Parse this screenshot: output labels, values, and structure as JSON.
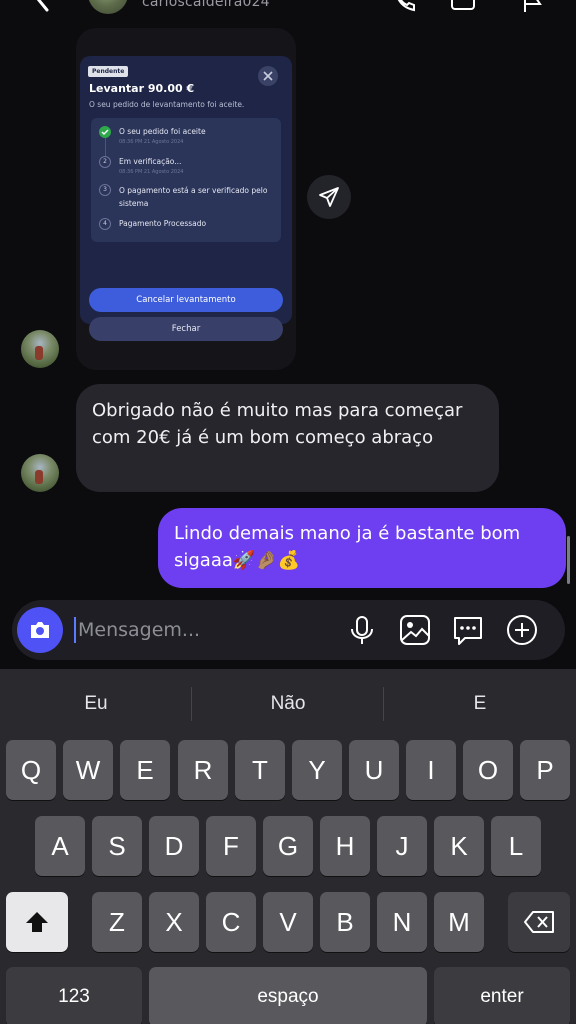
{
  "header": {
    "username": "carloscaldeira024",
    "back_icon": "chevron-left-icon",
    "actions": [
      "phone-icon",
      "video-icon",
      "flag-icon"
    ]
  },
  "shared_card": {
    "badge": "Pendente",
    "title": "Levantar 90.00 €",
    "subtitle": "O seu pedido de levantamento foi aceite.",
    "steps": [
      {
        "number": "1",
        "label": "O seu pedido foi aceite",
        "time": "08:36 PM 21 Agosto 2024",
        "status": "done"
      },
      {
        "number": "2",
        "label": "Em verificação...",
        "time": "08:36 PM 21 Agosto 2024",
        "status": "current"
      },
      {
        "number": "3",
        "label": "O pagamento está a ser verificado pelo sistema",
        "time": "",
        "status": "pending"
      },
      {
        "number": "4",
        "label": "Pagamento Processado",
        "time": "",
        "status": "pending"
      }
    ],
    "cancel_label": "Cancelar levantamento",
    "close_label": "Fechar"
  },
  "messages": {
    "incoming": "Obrigado não é muito mas para começar com 20€ já é um bom começo abraço",
    "outgoing": "Lindo demais mano ja é bastante bom sigaaa🚀🤌🏽💰"
  },
  "composer": {
    "placeholder": "Mensagem...",
    "value": "",
    "icons": [
      "camera-icon",
      "microphone-icon",
      "image-icon",
      "sticker-icon",
      "plus-icon"
    ]
  },
  "keyboard": {
    "suggestions": [
      "Eu",
      "Não",
      "E"
    ],
    "row1": [
      "Q",
      "W",
      "E",
      "R",
      "T",
      "Y",
      "U",
      "I",
      "O",
      "P"
    ],
    "row2": [
      "A",
      "S",
      "D",
      "F",
      "G",
      "H",
      "J",
      "K",
      "L"
    ],
    "row3": [
      "Z",
      "X",
      "C",
      "V",
      "B",
      "N",
      "M"
    ],
    "numbers_label": "123",
    "space_label": "espaço",
    "enter_label": "enter"
  },
  "colors": {
    "background": "#0c0c0f",
    "outgoing_bubble": "#6d3ff0",
    "incoming_bubble": "#26262c",
    "camera_button": "#4f52f5",
    "card_background": "#1e2546",
    "card_primary_button": "#3d5ddc",
    "step_done": "#2ea84a"
  }
}
